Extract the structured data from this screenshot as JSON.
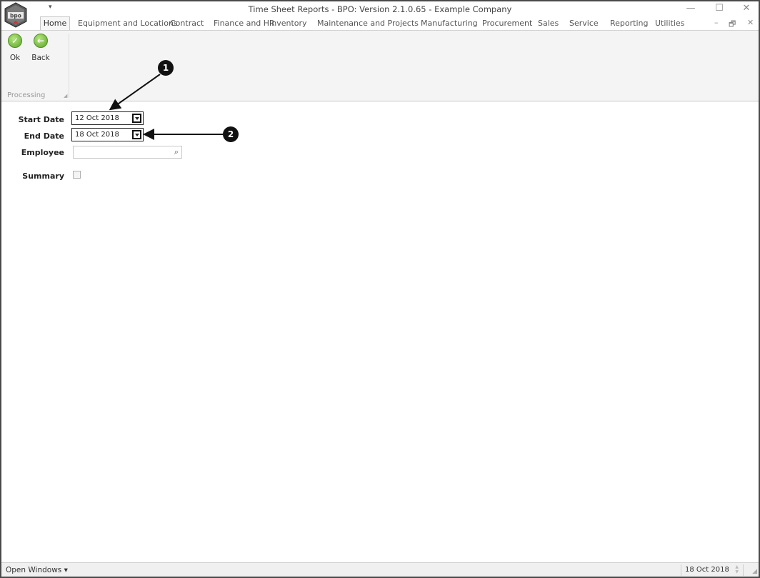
{
  "window": {
    "title": "Time Sheet Reports - BPO: Version 2.1.0.65 - Example Company",
    "logo_text": "bpo",
    "qat_glyph": "▾",
    "controls": {
      "minimize": "—",
      "maximize": "☐",
      "close": "✕"
    },
    "mdi_controls": {
      "minimize": "–",
      "restore": "🗗",
      "close": "✕"
    }
  },
  "tabs": [
    "Home",
    "Equipment and Locations",
    "Contract",
    "Finance and HR",
    "Inventory",
    "Maintenance and Projects",
    "Manufacturing",
    "Procurement",
    "Sales",
    "Service",
    "Reporting",
    "Utilities"
  ],
  "ribbon": {
    "ok_label": "Ok",
    "back_label": "Back",
    "group_label": "Processing",
    "ok_icon": "checkmark-icon",
    "back_icon": "back-arrow-icon"
  },
  "form": {
    "start_date_label": "Start Date",
    "start_date_value": "12 Oct 2018",
    "end_date_label": "End Date",
    "end_date_value": "18 Oct 2018",
    "employee_label": "Employee",
    "employee_value": "",
    "summary_label": "Summary",
    "summary_checked": false
  },
  "annotations": {
    "one": "1",
    "two": "2"
  },
  "statusbar": {
    "open_windows": "Open Windows ▾",
    "date": "18 Oct 2018"
  },
  "colors": {
    "ribbon_bg": "#f4f4f4",
    "accent_green": "#5ca526",
    "annotation": "#111111"
  }
}
